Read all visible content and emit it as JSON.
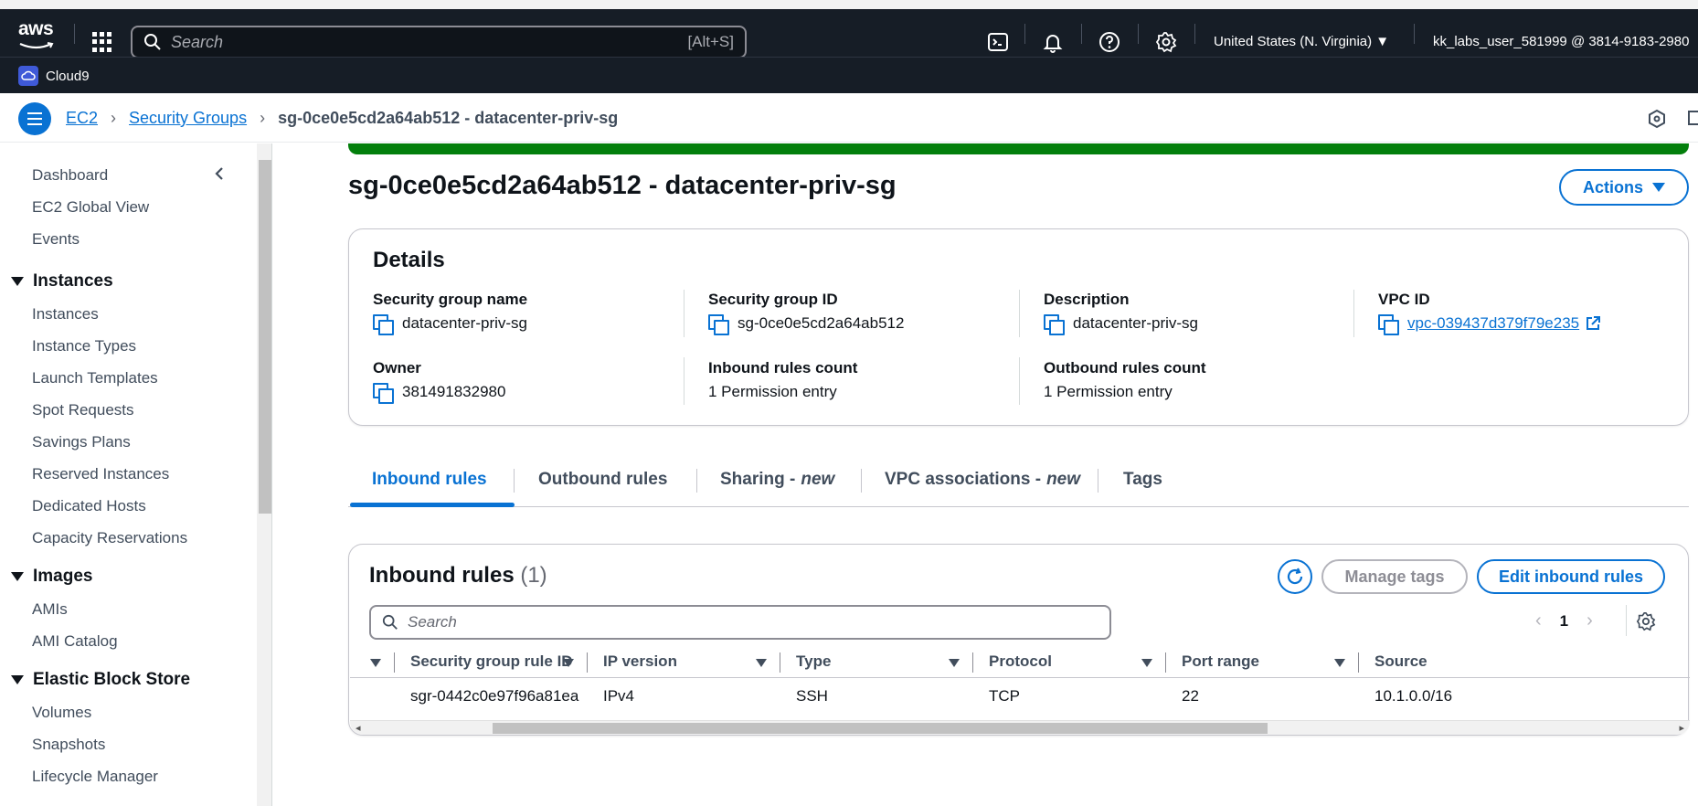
{
  "topnav": {
    "logo_text": "aws",
    "search_placeholder": "Search",
    "search_shortcut": "[Alt+S]",
    "region": "United States (N. Virginia) ▼",
    "user": "kk_labs_user_581999 @ 3814-9183-2980",
    "icons": [
      "cloudshell-icon",
      "bell-icon",
      "help-icon",
      "gear-icon"
    ]
  },
  "subbar": {
    "service": "Cloud9"
  },
  "breadcrumb": {
    "items": [
      "EC2",
      "Security Groups"
    ],
    "current": "sg-0ce0e5cd2a64ab512 - datacenter-priv-sg"
  },
  "sidebar": {
    "top_items": [
      "Dashboard",
      "EC2 Global View",
      "Events"
    ],
    "sections": [
      {
        "title": "Instances",
        "items": [
          "Instances",
          "Instance Types",
          "Launch Templates",
          "Spot Requests",
          "Savings Plans",
          "Reserved Instances",
          "Dedicated Hosts",
          "Capacity Reservations"
        ]
      },
      {
        "title": "Images",
        "items": [
          "AMIs",
          "AMI Catalog"
        ]
      },
      {
        "title": "Elastic Block Store",
        "items": [
          "Volumes",
          "Snapshots",
          "Lifecycle Manager"
        ]
      }
    ]
  },
  "page": {
    "title": "sg-0ce0e5cd2a64ab512 - datacenter-priv-sg",
    "actions_label": "Actions"
  },
  "details": {
    "title": "Details",
    "fields": [
      {
        "label": "Security group name",
        "value": "datacenter-priv-sg"
      },
      {
        "label": "Security group ID",
        "value": "sg-0ce0e5cd2a64ab512"
      },
      {
        "label": "Description",
        "value": "datacenter-priv-sg"
      },
      {
        "label": "VPC ID",
        "value": "vpc-039437d379f79e235"
      },
      {
        "label": "Owner",
        "value": "381491832980"
      },
      {
        "label": "Inbound rules count",
        "value": "1 Permission entry"
      },
      {
        "label": "Outbound rules count",
        "value": "1 Permission entry"
      }
    ]
  },
  "tabs": {
    "inbound": "Inbound rules",
    "outbound": "Outbound rules",
    "sharing": "Sharing -",
    "sharing_new": "new",
    "vpc_assoc": "VPC associations -",
    "vpc_assoc_new": "new",
    "tags": "Tags"
  },
  "inbound": {
    "title": "Inbound rules",
    "count": "(1)",
    "manage_tags": "Manage tags",
    "edit_rules": "Edit inbound rules",
    "search_placeholder": "Search",
    "page": "1",
    "columns": [
      "Security group rule ID",
      "IP version",
      "Type",
      "Protocol",
      "Port range",
      "Source"
    ],
    "rows": [
      [
        "sgr-0442c0e97f96a81ea",
        "IPv4",
        "SSH",
        "TCP",
        "22",
        "10.1.0.0/16"
      ]
    ]
  },
  "colors": {
    "nav_bg": "#161d26",
    "accent": "#0972d3",
    "success": "#037f0c"
  }
}
